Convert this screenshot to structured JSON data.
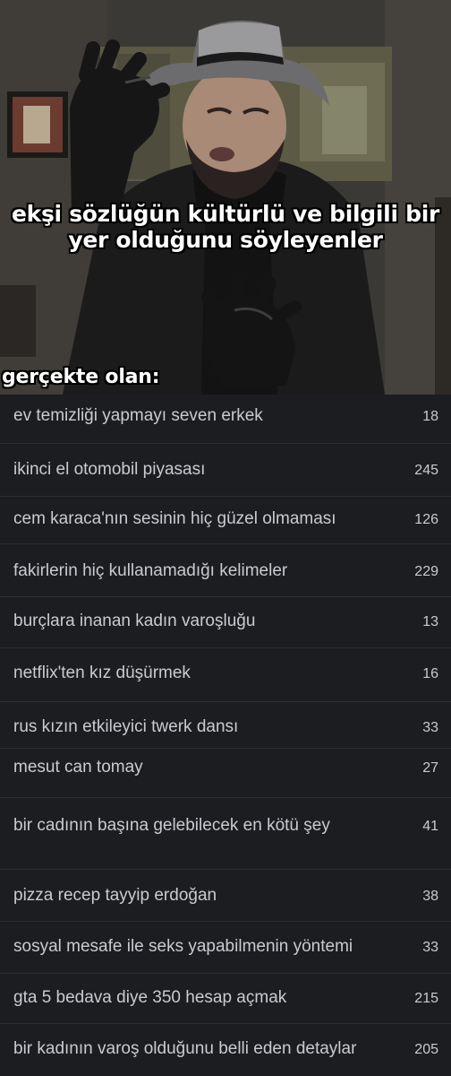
{
  "meme": {
    "caption_top": "ekşi sözlüğün kültürlü ve bilgili bir yer olduğunu söyleyenler",
    "caption_bottom": "gerçekte olan:"
  },
  "topics": [
    {
      "title": "ev temizliği yapmayı seven erkek",
      "count": "18"
    },
    {
      "title": "ikinci el otomobil piyasası",
      "count": "245"
    },
    {
      "title": "cem karaca'nın sesinin hiç güzel olmaması",
      "count": "126"
    },
    {
      "title": "fakirlerin hiç kullanamadığı kelimeler",
      "count": "229"
    },
    {
      "title": "burçlara inanan kadın varoşluğu",
      "count": "13"
    },
    {
      "title": "netflix'ten kız düşürmek",
      "count": "16"
    },
    {
      "title": "rus kızın etkileyici twerk dansı",
      "count": "33"
    },
    {
      "title": "mesut can tomay",
      "count": "27"
    },
    {
      "title": "bir cadının başına gelebilecek en kötü şey",
      "count": "41"
    },
    {
      "title": "pizza recep tayyip erdoğan",
      "count": "38"
    },
    {
      "title": "sosyal mesafe ile seks yapabilmenin yöntemi",
      "count": "33"
    },
    {
      "title": "gta 5 bedava diye 350 hesap açmak",
      "count": "215"
    },
    {
      "title": "bir kadının varoş olduğunu belli eden detaylar",
      "count": "205"
    }
  ],
  "colors": {
    "background": "#1c1d20",
    "text": "#c8cbd0",
    "divider": "#2c2d31"
  }
}
